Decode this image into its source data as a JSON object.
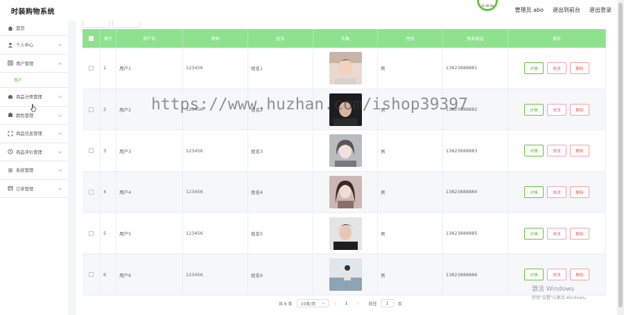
{
  "app": {
    "title": "时装购物系统",
    "clock_text": "11:56:26"
  },
  "topbar": {
    "admin": "管理员 abo",
    "back_home": "退出到前台",
    "logout": "退出登录"
  },
  "sidebar": {
    "items": [
      {
        "label": "首页",
        "icon": "home-icon"
      },
      {
        "label": "个人中心",
        "icon": "user-icon"
      },
      {
        "label": "用户管理",
        "icon": "users-icon"
      },
      {
        "label": "商品分类管理",
        "icon": "category-icon"
      },
      {
        "label": "颜色管理",
        "icon": "color-icon"
      },
      {
        "label": "商品信息管理",
        "icon": "goods-icon"
      },
      {
        "label": "商品评价管理",
        "icon": "review-icon"
      },
      {
        "label": "系统管理",
        "icon": "settings-icon"
      },
      {
        "label": "订单管理",
        "icon": "order-icon"
      }
    ],
    "sub_item": "用户"
  },
  "table": {
    "headers": [
      "索引",
      "用户名",
      "密码",
      "姓名",
      "头像",
      "性别",
      "联系电话",
      "操作"
    ],
    "actions": {
      "detail": "详情",
      "edit": "修改",
      "delete": "删除"
    },
    "rows": [
      {
        "index": "1",
        "username": "用户1",
        "password": "123456",
        "name": "姓名1",
        "gender": "男",
        "phone": "13823888881",
        "avatar": "avatar-photo"
      },
      {
        "index": "2",
        "username": "用户2",
        "password": "123456",
        "name": "姓名2",
        "gender": "男",
        "phone": "13823888882",
        "avatar": "avatar-photo"
      },
      {
        "index": "3",
        "username": "用户3",
        "password": "123456",
        "name": "姓名3",
        "gender": "男",
        "phone": "13823888883",
        "avatar": "avatar-photo"
      },
      {
        "index": "4",
        "username": "用户4",
        "password": "123456",
        "name": "姓名4",
        "gender": "男",
        "phone": "13823888884",
        "avatar": "avatar-photo"
      },
      {
        "index": "5",
        "username": "用户5",
        "password": "123456",
        "name": "姓名5",
        "gender": "男",
        "phone": "13823888885",
        "avatar": "avatar-photo"
      },
      {
        "index": "6",
        "username": "用户6",
        "password": "123456",
        "name": "姓名6",
        "gender": "男",
        "phone": "13823888886",
        "avatar": "avatar-photo"
      }
    ]
  },
  "pagination": {
    "total": "共 6 条",
    "page_size": "10条/页",
    "current": "1",
    "goto_label": "前往",
    "goto_value": "1",
    "page_suffix": "页",
    "prev": "‹",
    "next": "›"
  },
  "overlay": {
    "watermark": "https://www.huzhan.com/ishop39397",
    "activate_title": "激活 Windows",
    "activate_sub": "转到\"设置\"以激活 Windows。"
  },
  "colors": {
    "accent": "#67c23a",
    "header_bg": "#8ee28e",
    "edit": "#e3608f",
    "delete": "#e85c5c"
  }
}
